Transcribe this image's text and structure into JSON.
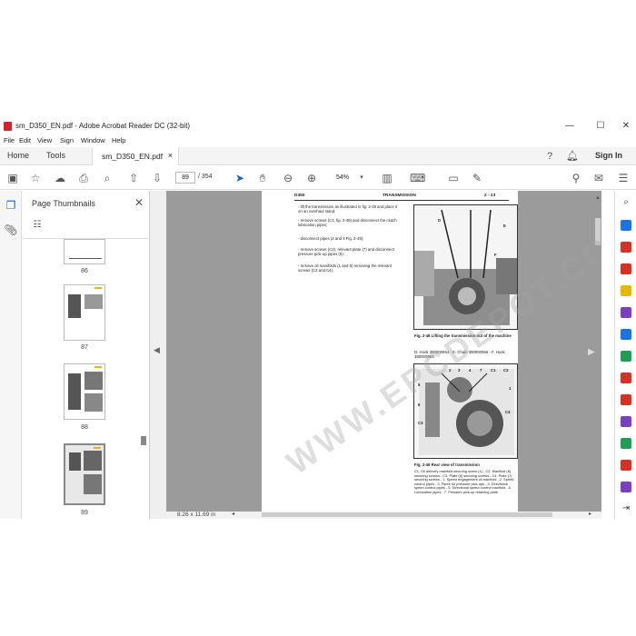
{
  "window": {
    "title": "sm_D350_EN.pdf - Adobe Acrobat Reader DC (32-bit)",
    "minimize": "—",
    "maximize": "☐",
    "close": "✕"
  },
  "menu": [
    "File",
    "Edit",
    "View",
    "Sign",
    "Window",
    "Help"
  ],
  "tabs": {
    "home": "Home",
    "tools": "Tools",
    "document": "sm_D350_EN.pdf",
    "document_close": "×",
    "sign_in": "Sign In"
  },
  "toolbar": {
    "current_page": "89",
    "page_count": "/ 354",
    "zoom": "54%"
  },
  "thumbnails": {
    "title": "Page Thumbnails",
    "close": "✕",
    "pages": [
      "86",
      "87",
      "88",
      "89"
    ]
  },
  "status": {
    "page_size": "8.26 x 11.69 in"
  },
  "document": {
    "header_left": "D350",
    "header_center": "TRANSMISSION",
    "header_right": "2 - 23",
    "steps": [
      "- lift the transmission as illustrated in fig. 2-48 and place it on an overhaul stand.",
      "- remove screws (C1, fig. 2-49) and disconnect the clutch lubrication pipes;",
      "- disconnect pipes (2 and 4 Fig. 2-49);",
      "- remove screws (C2), relevant plate (7) and disconnect pressure pick-up pipes (5).",
      "- remove oil manifolds (1 and 5) removing the relevant screws (C3 and C4)."
    ],
    "fig1_caption": "Fig. 2-48    Lifting the transmission out of the machine",
    "fig1_parts": "D. Hook 380000964 - E. Chain 380000966 - F. Hook 380000963.",
    "fig2_caption": "Fig. 2-49    Rear view of transmission",
    "fig2_parts": "C1. Oil delivery manifold securing screw (1) - C2. Manifold (6) securing screws - C3. Plate (6) securing screws - C4. Plate (7) securing screws - 1. Speed engagement oil manifold - 2. Speed control pipes - 3. Pipes for pressure pick-ups - 4. Directional speed control pipes - 5. Directional speed control manifold - 6. Lubrication pipes - 7. Pressure pick-up retaining plate.",
    "fig1_labels": [
      "D",
      "E",
      "F"
    ],
    "fig2_labels": [
      "2",
      "3",
      "4",
      "5",
      "6",
      "7",
      "1",
      "C1",
      "C2",
      "C3",
      "C4"
    ],
    "watermark": "WWW.EPCDEPOT.COM"
  }
}
